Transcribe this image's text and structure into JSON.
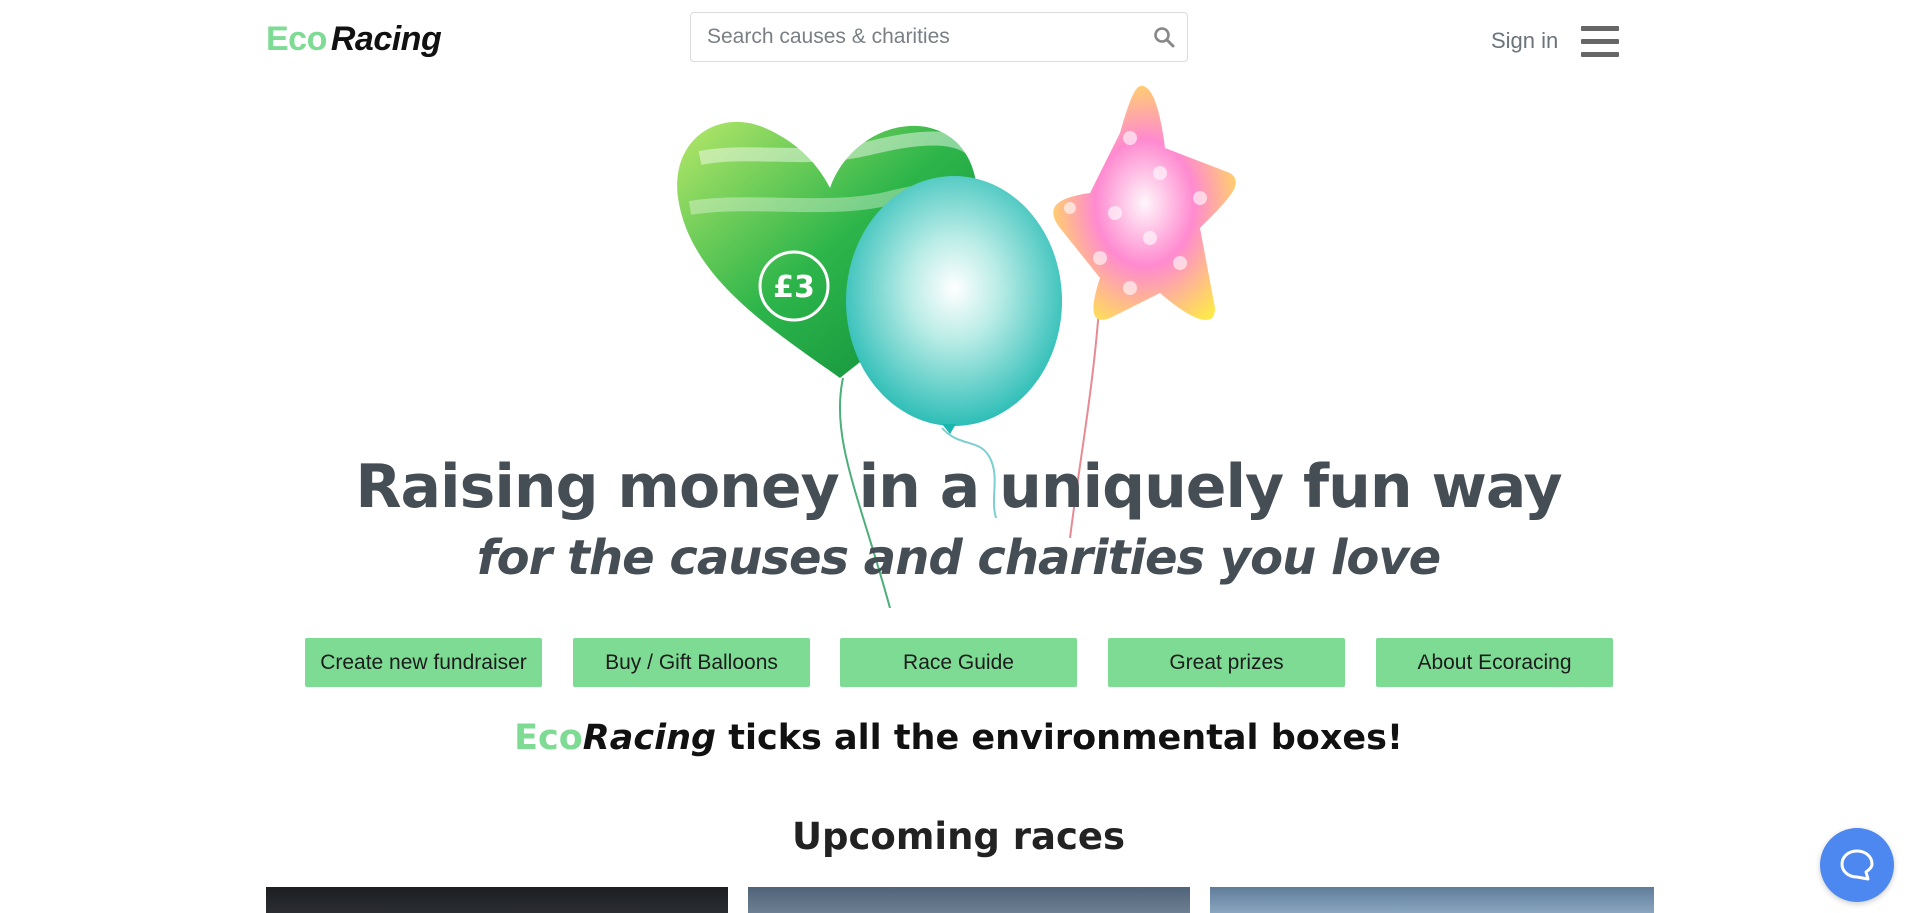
{
  "header": {
    "logo_eco": "Eco",
    "logo_racing": "Racing",
    "search_placeholder": "Search causes & charities",
    "signin": "Sign in"
  },
  "hero": {
    "headline": "Raising money in a uniquely fun way",
    "subline": "for the causes and charities you love",
    "balloon_price": "£3"
  },
  "buttons": [
    {
      "label": "Create new fundraiser"
    },
    {
      "label": "Buy / Gift Balloons"
    },
    {
      "label": "Race Guide"
    },
    {
      "label": "Great prizes"
    },
    {
      "label": "About Ecoracing"
    }
  ],
  "tagline": {
    "eco": "Eco",
    "racing": "Racing",
    "rest": " ticks all the environmental boxes!"
  },
  "upcoming": {
    "title": "Upcoming races"
  },
  "colors": {
    "brand_green": "#7ddb94",
    "text_dark": "#454d55",
    "chat_blue": "#4d87f0"
  },
  "icons": [
    "search-icon",
    "hamburger-menu-icon",
    "chat-support-icon"
  ]
}
